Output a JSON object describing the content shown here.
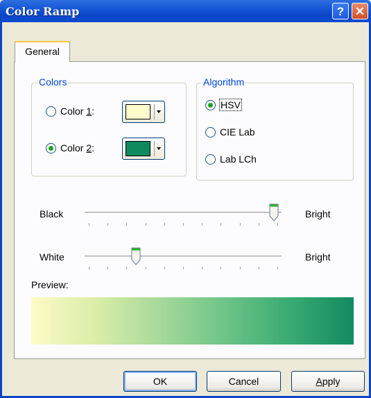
{
  "window": {
    "title": "Color Ramp",
    "help_label": "?",
    "close_label": "✕"
  },
  "tabs": [
    {
      "label": "General",
      "active": true
    }
  ],
  "colors_group": {
    "title": "Colors",
    "color1": {
      "prefix": "Color ",
      "accel": "1",
      "suffix": ":",
      "selected": false,
      "swatch": "#fffbcc"
    },
    "color2": {
      "prefix": "Color ",
      "accel": "2",
      "suffix": ":",
      "selected": true,
      "swatch": "#0e8a5e"
    }
  },
  "algorithm_group": {
    "title": "Algorithm",
    "options": [
      {
        "label": "HSV",
        "selected": true
      },
      {
        "label": "CIE Lab",
        "selected": false
      },
      {
        "label": "Lab LCh",
        "selected": false
      }
    ]
  },
  "sliders": [
    {
      "left_label": "Black",
      "right_label": "Bright",
      "value_fraction": 0.98
    },
    {
      "left_label": "White",
      "right_label": "Bright",
      "value_fraction": 0.25
    }
  ],
  "preview": {
    "label": "Preview:",
    "start_color": "#fdfbc6",
    "end_color": "#138a61"
  },
  "buttons": {
    "ok": "OK",
    "cancel": "Cancel",
    "apply_accel": "A",
    "apply_rest": "pply"
  }
}
